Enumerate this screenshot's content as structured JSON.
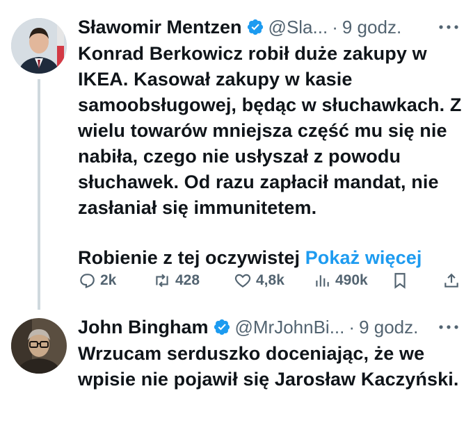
{
  "tweets": [
    {
      "author_name": "Sławomir Mentzen",
      "handle": "@Sla...",
      "separator": "·",
      "time": "9 godz.",
      "avatar": "person-portrait",
      "body": "Konrad Berkowicz robił duże zakupy w IKEA. Kasował zakupy w kasie samoobsługowej, będąc w słuchawkach. Z wielu towarów mniejsza część mu się nie nabiła, czego nie usłyszał z powodu słuchawek. Od razu zapłacił mandat, nie zasłaniał się immunitetem.",
      "preview": "Robienie z tej oczywistej",
      "show_more": "Pokaż więcej",
      "stats": {
        "replies": "2k",
        "retweets": "428",
        "likes": "4,8k",
        "views": "490k"
      }
    },
    {
      "author_name": "John Bingham",
      "handle": "@MrJohnBi...",
      "separator": "·",
      "time": "9 godz.",
      "avatar": "person-portrait",
      "body": "Wrzucam serduszko doceniając, że we wpisie nie pojawił się Jarosław Kaczyński."
    }
  ],
  "colors": {
    "text": "#0f1419",
    "secondary": "#536471",
    "link": "#1d9bf0",
    "verified": "#1d9bf0",
    "thread_line": "#cfd9de"
  }
}
